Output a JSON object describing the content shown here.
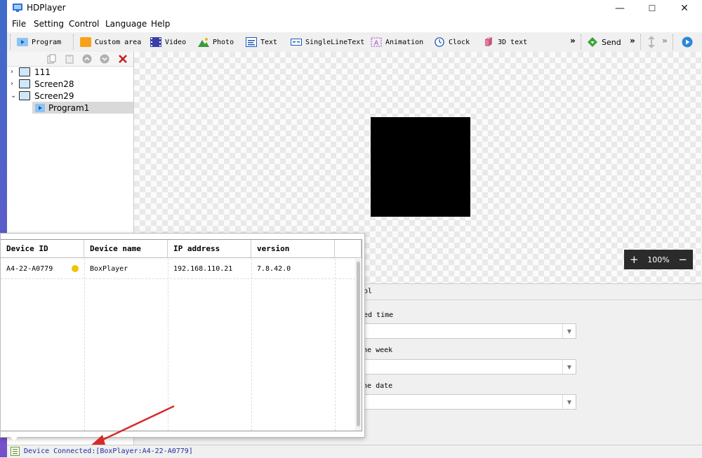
{
  "app": {
    "title": "HDPlayer"
  },
  "window_controls": {
    "minimize": "—",
    "maximize": "☐",
    "close": "✕"
  },
  "menu": [
    "File",
    "Setting",
    "Control",
    "Language",
    "Help"
  ],
  "toolbar": {
    "program": "Program",
    "custom_area": "Custom area",
    "video": "Video",
    "photo": "Photo",
    "text": "Text",
    "single_line_text": "SingleLineText",
    "animation": "Animation",
    "clock": "Clock",
    "text_3d": "3D text",
    "more": "»",
    "send": "Send"
  },
  "tree": [
    {
      "label": "111",
      "arrow": "›"
    },
    {
      "label": "Screen28",
      "arrow": "›"
    },
    {
      "label": "Screen29",
      "arrow": "⌄"
    },
    {
      "label": "Program1"
    }
  ],
  "zoom": {
    "plus": "+",
    "value": "100%",
    "minus": "−"
  },
  "right_panel": {
    "header": "ol",
    "label1": "ed time",
    "label2": "the week",
    "label3": "the date"
  },
  "device_table": {
    "columns": [
      "Device ID",
      "Device name",
      "IP address",
      "version"
    ],
    "rows": [
      {
        "device_id": "A4-22-A0779",
        "device_name": "BoxPlayer",
        "ip": "192.168.110.21",
        "version": "7.8.42.0",
        "status_color": "#f0c400"
      }
    ]
  },
  "status": {
    "text": "Device Connected:[BoxPlayer:A4-22-A0779]"
  },
  "colors": {
    "accent": "#1a2ea0",
    "arrow": "#d62a2a"
  }
}
